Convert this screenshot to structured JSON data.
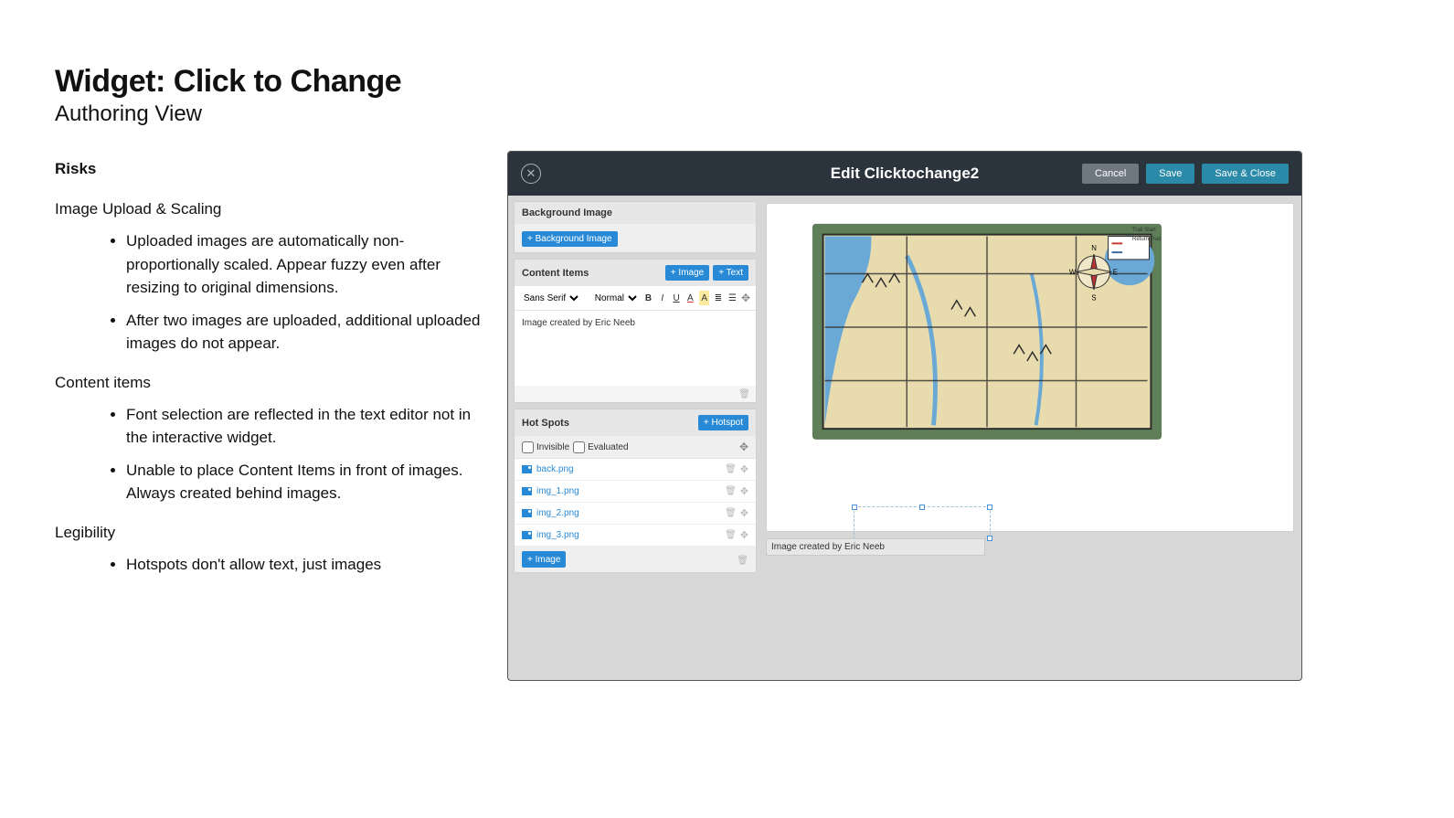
{
  "doc": {
    "title": "Widget: Click to Change",
    "subtitle": "Authoring View",
    "risks_heading": "Risks",
    "sections": [
      {
        "heading": "Image Upload & Scaling",
        "bullets": [
          "Uploaded images are automatically non-proportionally scaled. Appear fuzzy even after resizing to original dimensions.",
          "After two images are uploaded, additional uploaded images do not appear."
        ]
      },
      {
        "heading": "Content items",
        "bullets": [
          "Font selection are reflected in the text editor not in the interactive widget.",
          "Unable to place Content Items in front of images. Always created behind images."
        ]
      },
      {
        "heading": "Legibility",
        "bullets": [
          "Hotspots don't allow text, just images"
        ]
      }
    ]
  },
  "editor": {
    "window_title": "Edit Clicktochange2",
    "actions": {
      "cancel": "Cancel",
      "save": "Save",
      "save_close": "Save & Close"
    },
    "bg_section": {
      "title": "Background Image",
      "button": "+ Background Image"
    },
    "content_section": {
      "title": "Content Items",
      "add_image": "+ Image",
      "add_text": "+ Text",
      "font": "Sans Serif",
      "weight": "Normal",
      "text": "Image created by Eric Neeb"
    },
    "hotspot_section": {
      "title": "Hot Spots",
      "add": "+ Hotspot",
      "invisible": "Invisible",
      "evaluated": "Evaluated",
      "files": [
        "back.png",
        "img_1.png",
        "img_2.png",
        "img_3.png"
      ],
      "add_image": "+ Image"
    },
    "caption_on_canvas": "Image created by Eric Neeb",
    "map_legend": {
      "a": "Trail Start",
      "b": "Return Trail"
    }
  }
}
